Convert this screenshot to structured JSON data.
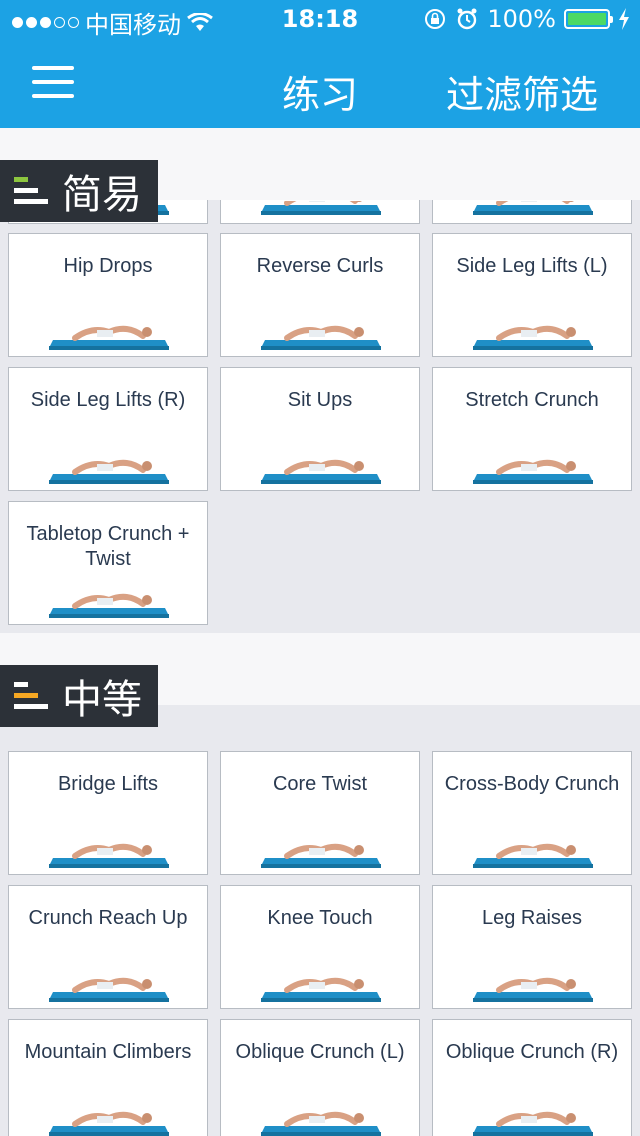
{
  "status_bar": {
    "carrier": "中国移动",
    "time": "18:18",
    "battery": "100%"
  },
  "nav": {
    "title": "练习",
    "filter_label": "过滤筛选"
  },
  "sections": [
    {
      "title": "简易",
      "accent": "#8dc63f",
      "cards": [
        "Hip Drops",
        "Reverse Curls",
        "Side Leg Lifts (L)",
        "Side Leg Lifts (R)",
        "Sit Ups",
        "Stretch Crunch",
        "Tabletop Crunch + Twist"
      ]
    },
    {
      "title": "中等",
      "accent": "#f7a823",
      "cards": [
        "Bridge Lifts",
        "Core Twist",
        "Cross-Body Crunch",
        "Crunch Reach Up",
        "Knee Touch",
        "Leg Raises",
        "Mountain Climbers",
        "Oblique Crunch (L)",
        "Oblique Crunch (R)"
      ]
    }
  ],
  "colors": {
    "nav_blue": "#1ca2e4",
    "mat_blue": "#1f8fc7",
    "label_dark": "#2c3138"
  }
}
